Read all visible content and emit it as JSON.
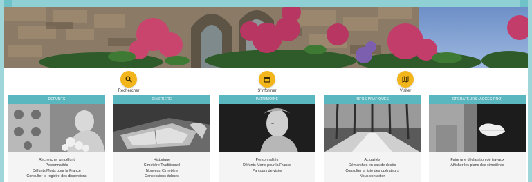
{
  "shortcuts": [
    {
      "label": "Rechercher",
      "icon": "search-icon"
    },
    {
      "label": "S'informer",
      "icon": "calendar-icon"
    },
    {
      "label": "Visiter",
      "icon": "map-icon"
    }
  ],
  "cards": [
    {
      "title": "DÉFUNTS",
      "links": [
        "Rechercher un défunt",
        "Personnalités",
        "Défunts Morts pour la France",
        "Consulter le registre des dispersions"
      ]
    },
    {
      "title": "CIMETIÈRE",
      "links": [
        "Historique",
        "Cimetière Traditionnel",
        "Nouveau Cimetière",
        "Concessions échues"
      ]
    },
    {
      "title": "PATRIMOINE",
      "links": [
        "Personnalités",
        "Défunts Morts pour la France",
        "Parcours de visite"
      ]
    },
    {
      "title": "INFOS PRATIQUES",
      "links": [
        "Actualités",
        "Démarches en cas de décès",
        "Consulter la liste des opérateurs",
        "Nous contacter"
      ]
    },
    {
      "title": "OPÉRATEURS (ACCÈS PRO)",
      "links": [
        "Faire une déclaration de travaux",
        "Afficher les plans des cimetières"
      ]
    }
  ],
  "colors": {
    "accent": "#5bb7bf",
    "shortcut": "#f2b51c",
    "frame": "#9fd6d9"
  }
}
